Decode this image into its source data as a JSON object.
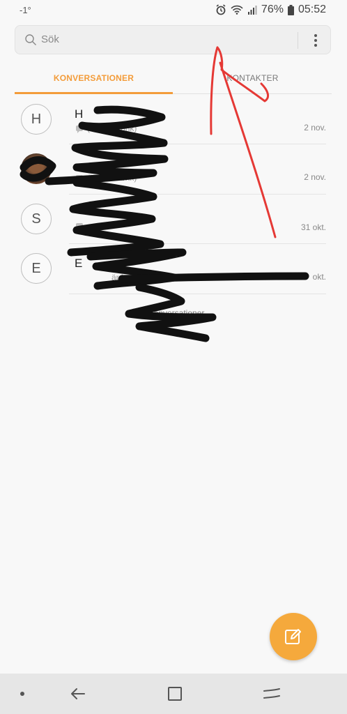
{
  "status_bar": {
    "temperature": "-1°",
    "battery": "76%",
    "time": "05:52",
    "icons": [
      "alarm-icon",
      "wifi-icon",
      "signal-icon",
      "battery-icon"
    ]
  },
  "search": {
    "placeholder": "Sök",
    "more_icon": "more-vert-icon"
  },
  "tabs": [
    {
      "label": "KONVERSATIONER",
      "active": true
    },
    {
      "label": "KONTAKTER",
      "active": false
    }
  ],
  "conversations": [
    {
      "initial": "H",
      "name": "H",
      "preview": "(Ingen rubrik)",
      "date": "2 nov."
    },
    {
      "initial": "",
      "name": "",
      "preview": "(Ingen rubrik)",
      "date": "2 nov."
    },
    {
      "initial": "S",
      "name": "",
      "preview": "",
      "date": "31 okt."
    },
    {
      "initial": "E",
      "name": "E",
      "preview": "är ju k",
      "date": "okt."
    }
  ],
  "conversation_count": "4 konversationer",
  "colors": {
    "accent": "#f39c3a",
    "fab": "#f5a93c",
    "annotation_red": "#e53935",
    "scribble": "#111111"
  },
  "fab": {
    "icon": "compose-icon"
  },
  "navbar": {
    "items": [
      "dot-icon",
      "back-icon",
      "recents-icon",
      "home-icon"
    ]
  }
}
